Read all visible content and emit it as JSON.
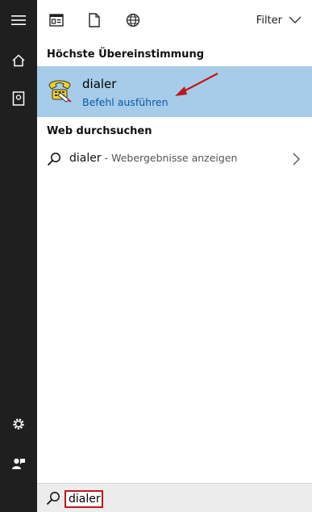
{
  "topbar": {
    "icons": [
      "apps-icon",
      "document-icon",
      "globe-icon"
    ],
    "filter_label": "Filter"
  },
  "best_match": {
    "heading": "Höchste Übereinstimmung",
    "app_name": "dialer",
    "action_label": "Befehl ausführen",
    "highlight_color": "#a6cce9",
    "annotation_arrow_color": "#c0161c"
  },
  "web_search": {
    "heading": "Web durchsuchen",
    "query": "dialer",
    "suffix": " - Webergebnisse anzeigen"
  },
  "leftbar": {
    "icons": [
      "hamburger-menu-icon",
      "home-icon",
      "notebook-icon",
      "settings-gear-icon",
      "feedback-person-icon"
    ]
  },
  "search_box": {
    "value": "dialer",
    "border_color": "#c0161c"
  }
}
